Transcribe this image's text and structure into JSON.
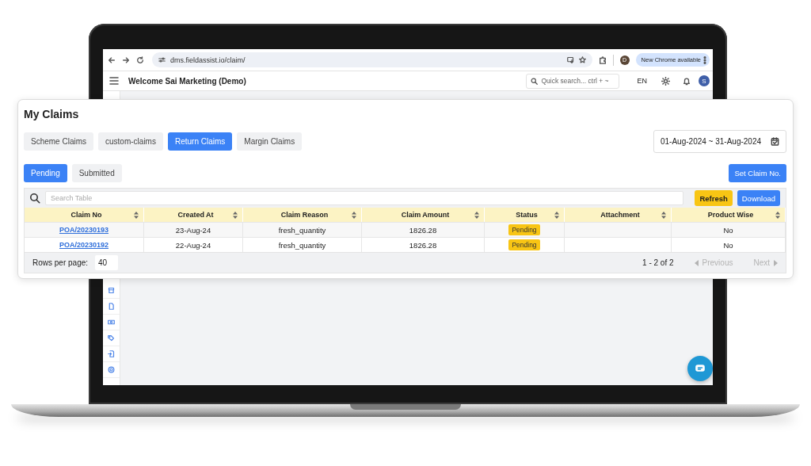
{
  "browser": {
    "url": "dms.fieldassist.io/claim/",
    "profile_initial": "D",
    "update_button": "New Chrome available"
  },
  "header": {
    "title": "Welcome Sai Marketing (Demo)",
    "search_placeholder": "Quick search... ctrl + ~",
    "language": "EN",
    "avatar_initial": "S"
  },
  "card": {
    "title": "My Claims",
    "claim_tabs": [
      {
        "label": "Scheme Claims",
        "selected": false
      },
      {
        "label": "custom-claims",
        "selected": false
      },
      {
        "label": "Return Claims",
        "selected": true
      },
      {
        "label": "Margin Claims",
        "selected": false
      }
    ],
    "date_range": "01-Aug-2024 ~ 31-Aug-2024",
    "status_tabs": [
      {
        "label": "Pending",
        "selected": true
      },
      {
        "label": "Submitted",
        "selected": false
      }
    ],
    "set_claim_button": "Set Claim No.",
    "search": {
      "placeholder": "Search Table"
    },
    "refresh_button": "Refresh",
    "download_button": "Download",
    "table": {
      "columns": [
        "Claim No",
        "Created At",
        "Claim Reason",
        "Claim Amount",
        "Status",
        "Attachment",
        "Product Wise"
      ],
      "rows": [
        {
          "claim_no": "POA/20230193",
          "created_at": "23-Aug-24",
          "claim_reason": "fresh_quantity",
          "claim_amount": "1826.28",
          "status": "Pending",
          "product_wise": "No"
        },
        {
          "claim_no": "POA/20230192",
          "created_at": "22-Aug-24",
          "claim_reason": "fresh_quantity",
          "claim_amount": "1826.28",
          "status": "Pending",
          "product_wise": "No"
        }
      ]
    },
    "rows_per_page_label": "Rows per page:",
    "rows_per_page": "40",
    "page_info": "1 - 2 of 2",
    "previous": {
      "label": "Previous",
      "disabled": true
    },
    "next": {
      "label": "Next",
      "disabled": true
    }
  }
}
